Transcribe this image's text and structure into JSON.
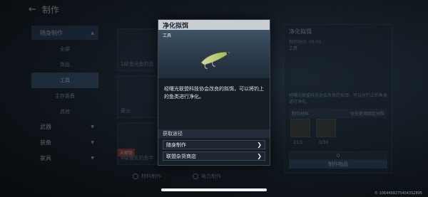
{
  "page": {
    "title": "制作"
  },
  "sidebar": {
    "groups": [
      {
        "label": "随身制作",
        "expanded": true,
        "items": [
          {
            "label": "全部",
            "active": false
          },
          {
            "label": "饰品",
            "active": false
          },
          {
            "label": "工具",
            "active": true
          },
          {
            "label": "主存装备",
            "active": false
          },
          {
            "label": "其他",
            "active": false
          }
        ]
      },
      {
        "label": "武器"
      },
      {
        "label": "装备"
      },
      {
        "label": "家具"
      }
    ]
  },
  "cards": [
    {
      "label": "1级渔光鱼钓鱼"
    },
    {
      "label": "黄火"
    },
    {
      "label": "4级渔光钓鱼竿",
      "tag": "未解锁"
    }
  ],
  "craft_modes": [
    {
      "label": "材料制作"
    },
    {
      "label": "电力制作"
    }
  ],
  "detail_panel": {
    "title": "净化拟饵",
    "craft_time": "制作时间: 00:03",
    "type": "工具",
    "description": "经曙光联盟科技协会改良的拟饵，可以将钓上的鱼类进行净化。",
    "materials_header": "制作材料",
    "materials_priority": "优先使用绑定材料",
    "material_counts": [
      "21/1",
      "0/30"
    ],
    "quantity": "0",
    "craft_button": "制作物品"
  },
  "modal": {
    "title": "净化拟饵",
    "type": "工具",
    "description": "经曙光联盟科技协会改良的拟饵，可以将钓上的鱼类进行净化。",
    "section_title": "获取途径",
    "sources": [
      {
        "label": "随身制作"
      },
      {
        "label": "联盟杂货商店"
      }
    ]
  },
  "footer": {
    "uid": "© 10644992754043S2895"
  },
  "icons": {
    "back": "back-arrow-icon",
    "source_chevron": "chevron-right-icon",
    "lure": "fishing-lure-icon"
  },
  "colors": {
    "modal_header": "#c9ced5",
    "active_nav": "#3c5574",
    "modal_bg": "#161d25",
    "locked_tag": "#b83a35"
  }
}
